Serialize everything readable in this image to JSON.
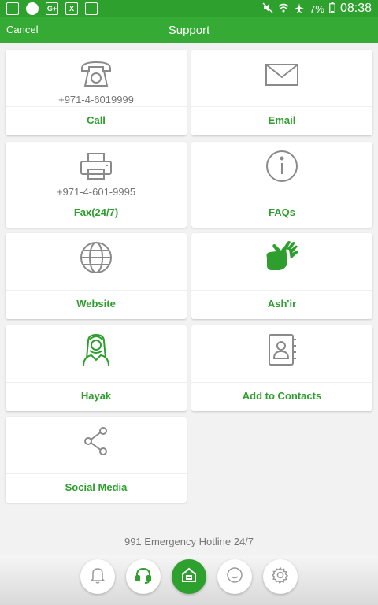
{
  "status_bar": {
    "battery": "7%",
    "time": "08:38"
  },
  "header": {
    "cancel_label": "Cancel",
    "title": "Support"
  },
  "cards": [
    {
      "label": "Call",
      "subtitle": "+971-4-6019999",
      "icon": "telephone-icon"
    },
    {
      "label": "Email",
      "subtitle": "",
      "icon": "envelope-icon"
    },
    {
      "label": "Fax(24/7)",
      "subtitle": "+971-4-601-9995",
      "icon": "printer-icon"
    },
    {
      "label": "FAQs",
      "subtitle": "",
      "icon": "info-icon"
    },
    {
      "label": "Website",
      "subtitle": "",
      "icon": "globe-icon"
    },
    {
      "label": "Ash'ir",
      "subtitle": "",
      "icon": "sign-language-hands-icon"
    },
    {
      "label": "Hayak",
      "subtitle": "",
      "icon": "person-avatar-icon"
    },
    {
      "label": "Add to Contacts",
      "subtitle": "",
      "icon": "contacts-book-icon"
    },
    {
      "label": "Social Media",
      "subtitle": "",
      "icon": "share-icon"
    }
  ],
  "footer": {
    "hotline": "991 Emergency Hotline 24/7"
  },
  "bottom_nav": [
    {
      "icon": "bell-icon",
      "active": false
    },
    {
      "icon": "headset-icon",
      "active": false
    },
    {
      "icon": "home-icon",
      "active": true
    },
    {
      "icon": "smiley-icon",
      "active": false
    },
    {
      "icon": "gear-icon",
      "active": false
    }
  ],
  "colors": {
    "brand": "#35ab35",
    "status_bar": "#2ea02e",
    "label": "#2e9e2e",
    "icon_gray": "#8a8a8a"
  }
}
